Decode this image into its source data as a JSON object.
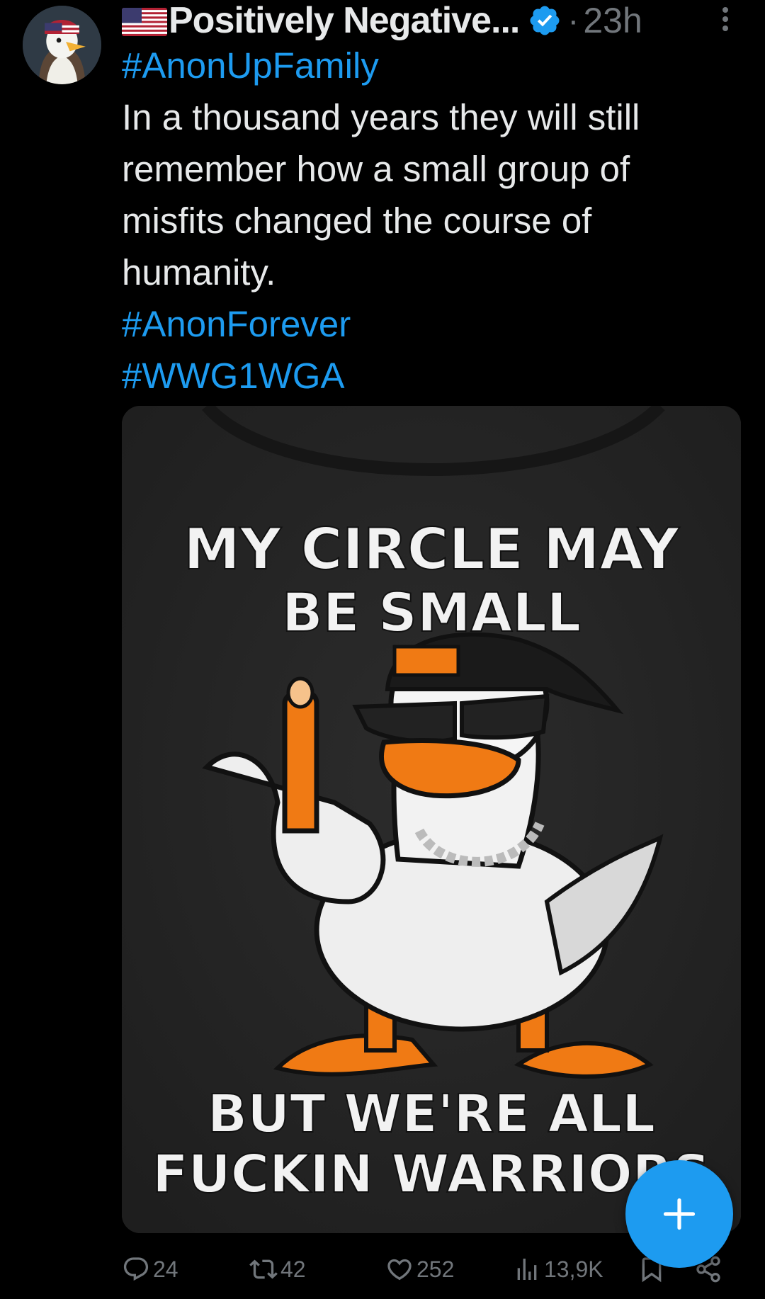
{
  "post": {
    "author": {
      "display_name": "Positively Negative...",
      "flag_icon": "us-flag-icon",
      "verified": true,
      "time": "23h"
    },
    "text_lines": [
      {
        "text": "#AnonUpFamily",
        "hashtag": true
      },
      {
        "text": "In a thousand years they will still",
        "hashtag": false
      },
      {
        "text": "remember how a small group of",
        "hashtag": false
      },
      {
        "text": "misfits changed the course of",
        "hashtag": false
      },
      {
        "text": "humanity.",
        "hashtag": false
      },
      {
        "text": "#AnonForever",
        "hashtag": true
      },
      {
        "text": "#WWG1WGA",
        "hashtag": true
      }
    ],
    "media": {
      "top_text_line1": "MY CIRCLE MAY",
      "top_text_line2": "BE SMALL",
      "bottom_text_line1": "BUT WE'RE ALL",
      "bottom_text_line2": "FUCKIN WARRIORS"
    },
    "actions": {
      "replies": "24",
      "reposts": "42",
      "likes": "252",
      "views": "13,9K"
    }
  },
  "colors": {
    "background": "#000000",
    "text": "#e7e9ea",
    "muted": "#71767b",
    "accent": "#1d9bf0"
  },
  "compose_button": {
    "icon": "plus-icon"
  }
}
